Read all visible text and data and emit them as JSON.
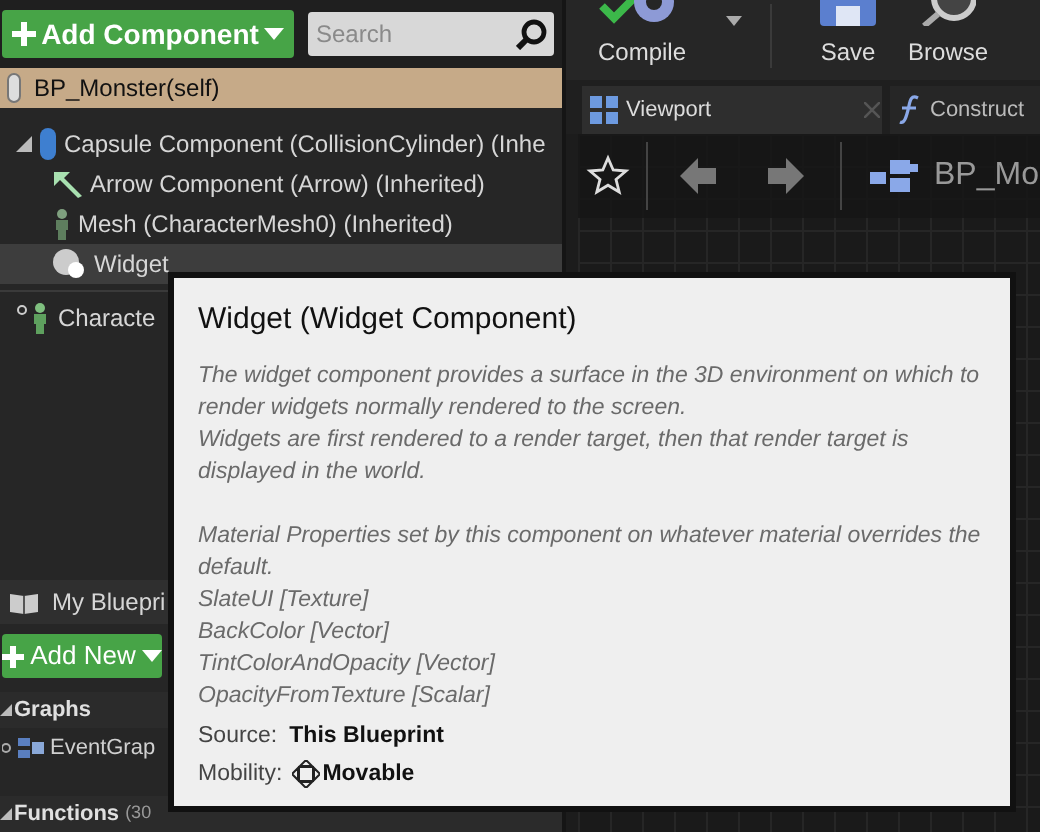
{
  "components_toolbar": {
    "add_component": "Add Component",
    "search": {
      "placeholder": "Search"
    }
  },
  "blueprint_root": {
    "label": "BP_Monster(self)"
  },
  "components": [
    {
      "label": "Capsule Component (CollisionCylinder) (Inhe",
      "kind": "capsule",
      "expanded": true,
      "selected": false,
      "children": [
        {
          "label": "Arrow Component (Arrow) (Inherited)",
          "kind": "arrow",
          "selected": false
        },
        {
          "label": "Mesh (CharacterMesh0) (Inherited)",
          "kind": "mesh",
          "selected": false
        },
        {
          "label": "Widget",
          "kind": "widget",
          "selected": true
        }
      ]
    },
    {
      "label": "Characte",
      "kind": "movement",
      "selected": false
    }
  ],
  "my_blueprint": {
    "tab": "My Bluepri",
    "add_new": "Add New",
    "sections": [
      {
        "title": "Graphs",
        "expanded": true,
        "items": [
          {
            "label": "EventGrap"
          }
        ]
      },
      {
        "title": "Functions",
        "count": "(30",
        "expanded": true
      }
    ]
  },
  "editor_toolbar": [
    {
      "label": "Compile",
      "kind": "compile",
      "dropdown": true
    },
    {
      "label": "Save",
      "kind": "save"
    },
    {
      "label": "Browse",
      "kind": "browse"
    }
  ],
  "tabs": [
    {
      "label": "Viewport",
      "kind": "viewport",
      "selected": true,
      "closable": true
    },
    {
      "label": "Construct",
      "kind": "function",
      "selected": false
    }
  ],
  "viewport": {
    "breadcrumb": "BP_Mo"
  },
  "tooltip": {
    "title": "Widget (Widget Component)",
    "description": [
      [
        "The widget component provides a surface in the 3D environment on which to render widgets normally rendered to the screen.",
        "Widgets are first rendered to a render target, then that render target is displayed in the world."
      ],
      [
        "Material Properties set by this component on whatever material overrides the default.",
        "SlateUI [Texture]",
        "BackColor [Vector]",
        "TintColorAndOpacity [Vector]",
        "OpacityFromTexture [Scalar]"
      ]
    ],
    "source": {
      "label": "Source:",
      "value": "This Blueprint"
    },
    "mobility": {
      "label": "Mobility:",
      "value": "Movable"
    }
  }
}
